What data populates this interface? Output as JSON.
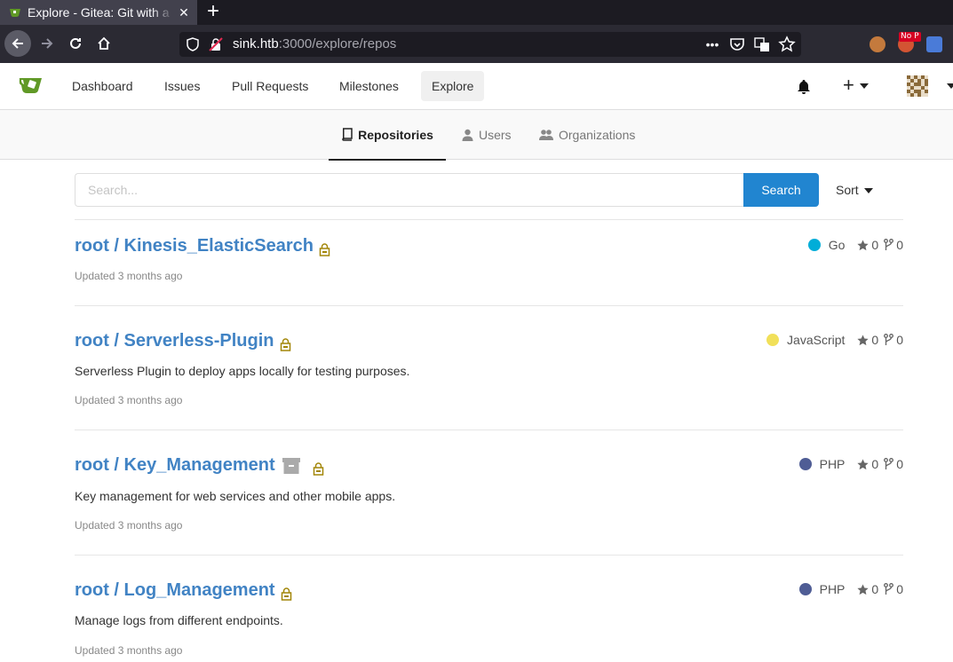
{
  "browser": {
    "tab_title": "Explore - Gitea: Git with a",
    "url_host": "sink.htb",
    "url_rest": ":3000/explore/repos",
    "nop_badge": "No P"
  },
  "header": {
    "menu": [
      "Dashboard",
      "Issues",
      "Pull Requests",
      "Milestones",
      "Explore"
    ],
    "active_menu": "Explore"
  },
  "subnav": {
    "tabs": [
      "Repositories",
      "Users",
      "Organizations"
    ],
    "active": "Repositories"
  },
  "search": {
    "placeholder": "Search...",
    "button_label": "Search",
    "sort_label": "Sort"
  },
  "repos": [
    {
      "name": "root / Kinesis_ElasticSearch",
      "private": true,
      "archived": false,
      "language": "Go",
      "language_color": "#00add8",
      "stars": "0",
      "forks": "0",
      "description": "",
      "updated": "Updated 3 months ago"
    },
    {
      "name": "root / Serverless-Plugin",
      "private": true,
      "archived": false,
      "language": "JavaScript",
      "language_color": "#f1e05a",
      "stars": "0",
      "forks": "0",
      "description": "Serverless Plugin to deploy apps locally for testing purposes.",
      "updated": "Updated 3 months ago"
    },
    {
      "name": "root / Key_Management",
      "private": true,
      "archived": true,
      "language": "PHP",
      "language_color": "#4f5d95",
      "stars": "0",
      "forks": "0",
      "description": "Key management for web services and other mobile apps.",
      "updated": "Updated 3 months ago"
    },
    {
      "name": "root / Log_Management",
      "private": true,
      "archived": false,
      "language": "PHP",
      "language_color": "#4f5d95",
      "stars": "0",
      "forks": "0",
      "description": "Manage logs from different endpoints.",
      "updated": "Updated 3 months ago"
    }
  ]
}
